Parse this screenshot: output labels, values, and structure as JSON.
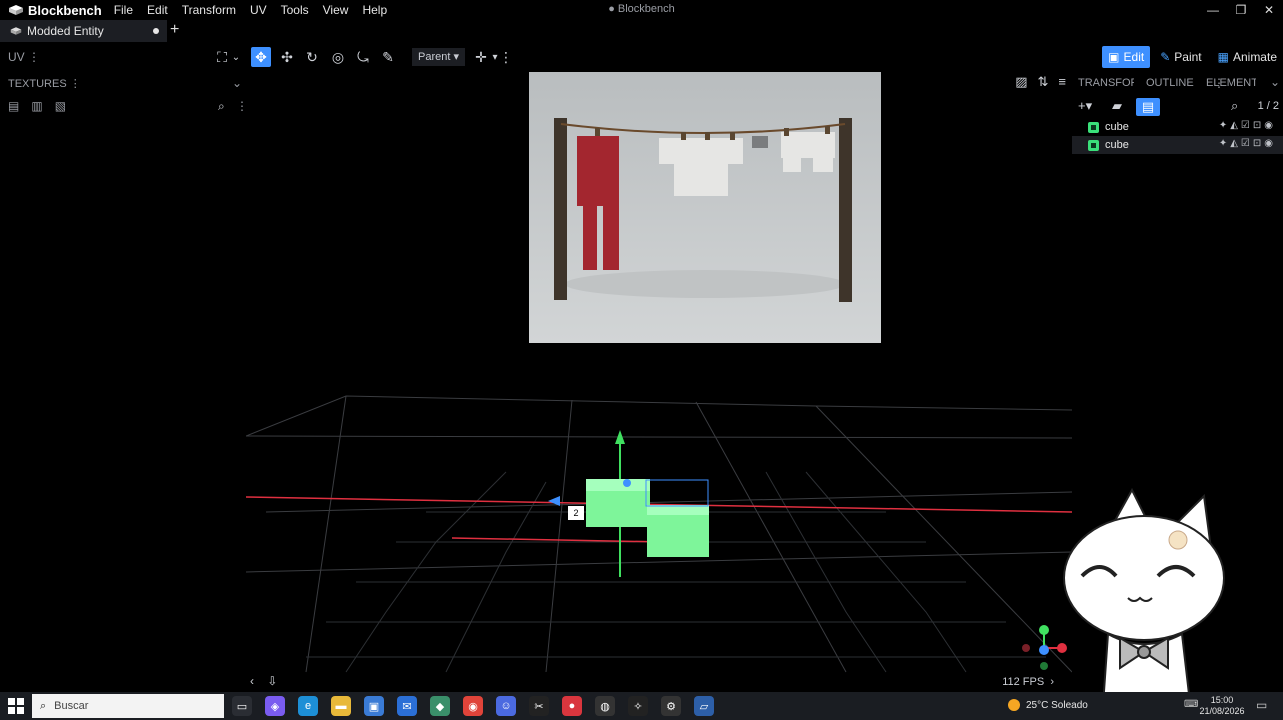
{
  "app": {
    "name": "Blockbench",
    "window_title": "Blockbench",
    "menu": [
      "File",
      "Edit",
      "Transform",
      "UV",
      "Tools",
      "View",
      "Help"
    ]
  },
  "tabs": {
    "project": "Modded Entity",
    "add": "+"
  },
  "toolbar": {
    "uv_label": "UV",
    "parent_label": "Parent",
    "modes": {
      "edit": "Edit",
      "paint": "Paint",
      "animate": "Animate"
    }
  },
  "left_panel": {
    "header": "TEXTURES"
  },
  "viewport": {
    "fps": "112 FPS",
    "selection_count_tag": "2"
  },
  "right_panel": {
    "tabs": [
      "TRANSFORM",
      "OUTLINER",
      "ELEMENT"
    ],
    "count": "1 / 2",
    "outliner": [
      {
        "name": "cube",
        "selected": false
      },
      {
        "name": "cube",
        "selected": true
      }
    ]
  },
  "taskbar": {
    "search_placeholder": "Buscar",
    "weather_temp": "25°C",
    "weather_desc": "Soleado",
    "time": "15:00",
    "date": "21/08/2026"
  },
  "colors": {
    "accent": "#3e90ff",
    "cube_green": "#7ef59a",
    "axis_red": "#e03040",
    "axis_green": "#40e060"
  }
}
